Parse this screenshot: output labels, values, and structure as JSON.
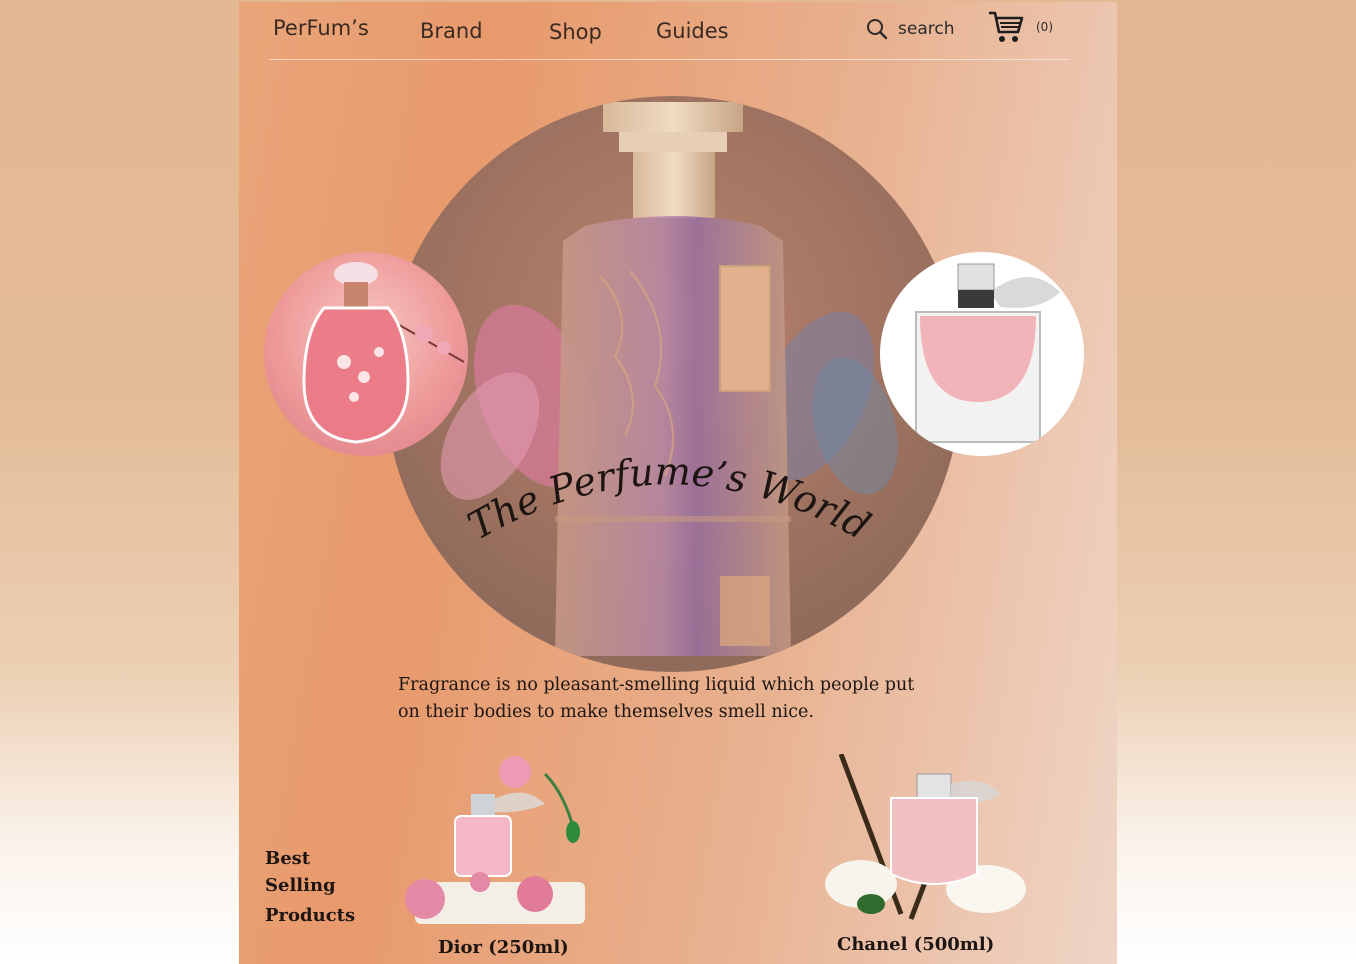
{
  "nav": {
    "logo": "PerFum’s",
    "links": [
      "Brand",
      "Shop",
      "Guides"
    ],
    "search_label": "search",
    "cart_count": "(0)"
  },
  "hero": {
    "title": "The Perfume’s World"
  },
  "tagline_line1": "Fragrance is no pleasant-smelling liquid which people put",
  "tagline_line2": "on their bodies to make themselves smell nice.",
  "best_selling": [
    "Best",
    "Selling",
    "Products"
  ],
  "products": [
    {
      "name": "Dior (250ml)"
    },
    {
      "name": "Chanel (500ml)"
    }
  ],
  "icons": {
    "search": "search-icon",
    "cart": "shopping-cart-icon"
  },
  "colors": {
    "accent": "#e89a6c",
    "text": "#1d1512"
  }
}
